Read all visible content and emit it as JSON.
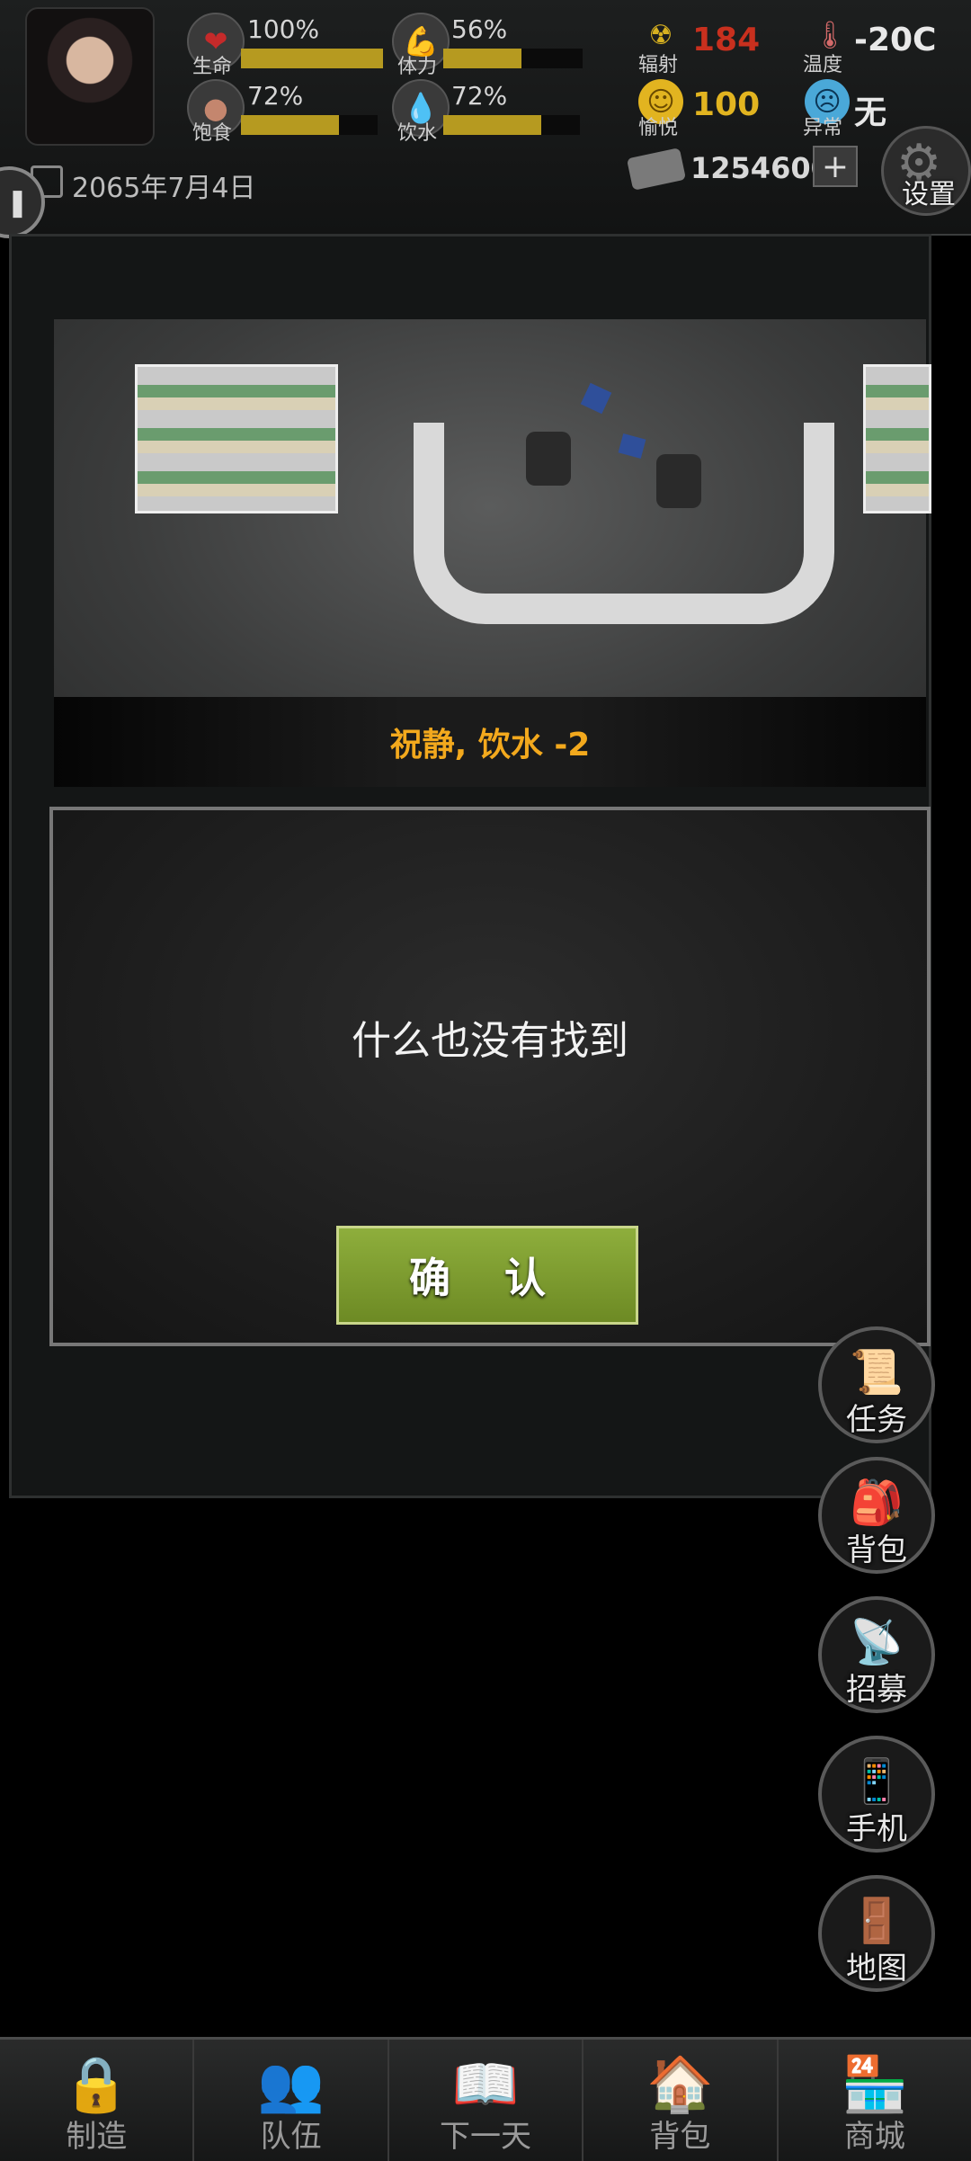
{
  "hud": {
    "stats": [
      {
        "label": "生命",
        "value": "100%",
        "fill": 1.0,
        "icon": "heart-icon"
      },
      {
        "label": "体力",
        "value": "56%",
        "fill": 0.56,
        "icon": "muscle-icon"
      },
      {
        "label": "饱食",
        "value": "72%",
        "fill": 0.72,
        "icon": "stomach-icon"
      },
      {
        "label": "饮水",
        "value": "72%",
        "fill": 0.72,
        "icon": "water-drop-icon"
      }
    ],
    "radiation": {
      "label": "辐射",
      "value": "184",
      "color": "#c8301e"
    },
    "temperature": {
      "label": "温度",
      "value": "-20C"
    },
    "mood": {
      "label": "愉悦",
      "value": "100",
      "color": "#e2b420"
    },
    "status": {
      "label": "异常",
      "value": "无"
    },
    "date": "2065年7月4日",
    "money": "1254600",
    "add_symbol": "+",
    "settings_label": "设置",
    "pause_symbol": "❚❚"
  },
  "scene": {
    "notification": "祝静, 饮水 -2"
  },
  "dialog": {
    "message": "什么也没有找到",
    "confirm_label": "确 认"
  },
  "side_buttons": [
    {
      "label": "任务",
      "icon": "scroll-icon"
    },
    {
      "label": "背包",
      "icon": "backpack-icon"
    },
    {
      "label": "招募",
      "icon": "satellite-dish-icon"
    },
    {
      "label": "手机",
      "icon": "phone-icon"
    },
    {
      "label": "地图",
      "icon": "door-exit-icon"
    }
  ],
  "bottom_nav": [
    {
      "label": "制造",
      "icon": "tools-lock-icon"
    },
    {
      "label": "队伍",
      "icon": "team-icon"
    },
    {
      "label": "下一天",
      "icon": "book-icon"
    },
    {
      "label": "背包",
      "icon": "house-icon"
    },
    {
      "label": "商城",
      "icon": "shop-icon"
    }
  ],
  "colors": {
    "accent": "#f3a91d",
    "bar": "#b69a20",
    "confirm": "#7f9d30"
  }
}
